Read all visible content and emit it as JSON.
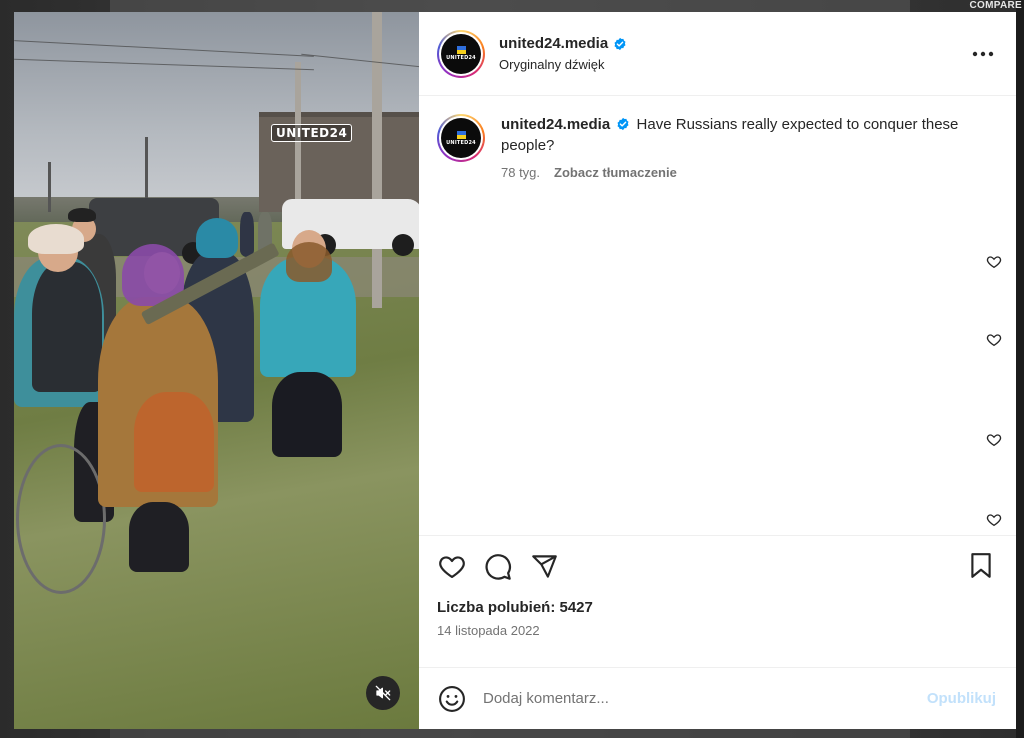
{
  "background": {
    "corner_text": "COMPARE"
  },
  "video": {
    "watermark": "UNITED24",
    "mute_icon": "volume-muted-icon"
  },
  "post": {
    "username": "united24.media",
    "avatar_logo_text": "UNITED24",
    "audio_label": "Oryginalny dźwięk",
    "more_icon": "more-horizontal-icon",
    "verified_color": "#0095f6",
    "caption": {
      "username": "united24.media",
      "text": "Have Russians really expected to conquer these people?",
      "age": "78 tyg.",
      "translate_label": "Zobacz tłumaczenie"
    },
    "actions": {
      "like_icon": "heart-icon",
      "comment_icon": "comment-icon",
      "share_icon": "share-icon",
      "save_icon": "bookmark-icon"
    },
    "likes_label": "Liczba polubień: 5427",
    "date": "14 listopada 2022",
    "comment_box": {
      "emoji_icon": "emoji-icon",
      "placeholder": "Dodaj komentarz...",
      "publish_label": "Opublikuj"
    }
  },
  "colors": {
    "publish_disabled": "#c2e1fb",
    "text_primary": "#262626",
    "text_secondary": "#737373"
  }
}
